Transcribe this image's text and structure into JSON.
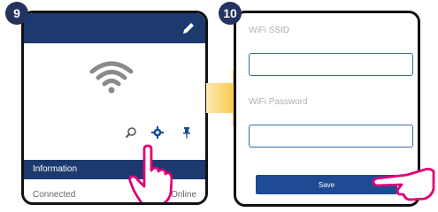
{
  "steps": {
    "step1": "9",
    "step2": "10"
  },
  "panel1": {
    "info_label": "Information",
    "connection_label": "Connected",
    "connection_value": "Online",
    "icons": [
      "pencil-icon",
      "wifi-icon",
      "search-icon",
      "gear-icon",
      "pin-icon",
      "pointing-hand-icon"
    ]
  },
  "panel2": {
    "ssid_label": "WiFi SSID",
    "password_label": "WiFi Password",
    "save_label": "Save",
    "icons": [
      "pointing-hand-icon"
    ]
  },
  "colors": {
    "navy": "#1d3a6e",
    "button_blue": "#1e4b93",
    "accent_magenta": "#e0007a",
    "arrow_yellow": "#f4b400"
  }
}
